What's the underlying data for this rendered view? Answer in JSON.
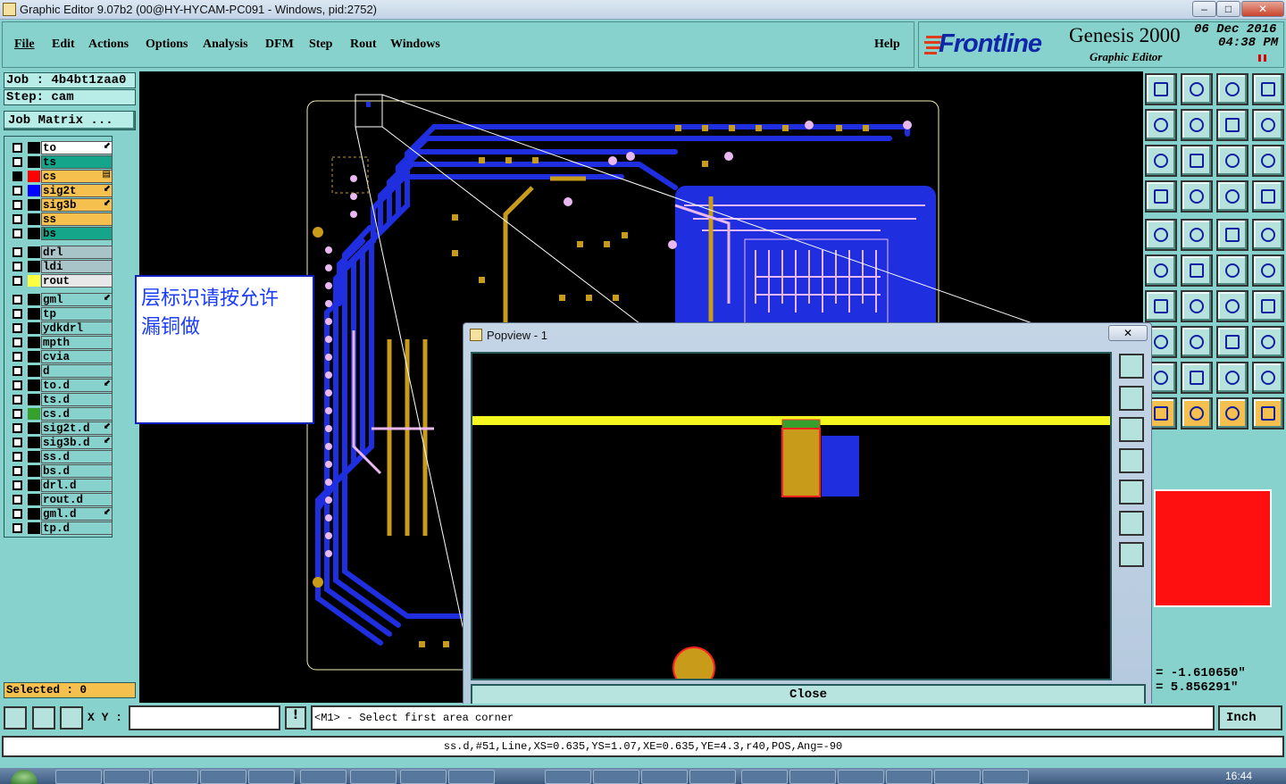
{
  "window": {
    "title": "Graphic Editor 9.07b2 (00@HY-HYCAM-PC091 - Windows, pid:2752)",
    "min": "–",
    "max": "□",
    "close": "✕"
  },
  "menu": {
    "items": [
      "File",
      "Edit",
      "Actions",
      "Options",
      "Analysis",
      "DFM",
      "Step",
      "Rout",
      "Windows"
    ],
    "help": "Help"
  },
  "logo": {
    "brand": "Frontline",
    "product": "Genesis 2000",
    "subtitle": "Graphic Editor",
    "date": "06 Dec 2016",
    "time": "04:38 PM"
  },
  "job": {
    "job_label": "Job : 4b4bt1zaa0",
    "step_label": "Step: cam",
    "matrix_button": "Job Matrix ..."
  },
  "layers": [
    {
      "name": "to",
      "color": "#ffffff",
      "swatch": "#000000",
      "mark": "⬋"
    },
    {
      "name": "ts",
      "color": "#14a58a",
      "swatch": "#000000",
      "mark": ""
    },
    {
      "name": "cs",
      "color": "#f5c04e",
      "swatch": "#ff0000",
      "mark": "▤",
      "selected": true
    },
    {
      "name": "sig2t",
      "color": "#f5c04e",
      "swatch": "#0000ff",
      "mark": "⬋"
    },
    {
      "name": "sig3b",
      "color": "#f5c04e",
      "swatch": "#000000",
      "mark": "⬋"
    },
    {
      "name": "ss",
      "color": "#f5c04e",
      "swatch": "#000000",
      "mark": ""
    },
    {
      "name": "bs",
      "color": "#14a58a",
      "swatch": "#000000",
      "mark": ""
    },
    {
      "name": "drl",
      "color": "#a8c4c8",
      "swatch": "#000000",
      "mark": ""
    },
    {
      "name": "ldi",
      "color": "#a8c4c8",
      "swatch": "#000000",
      "mark": ""
    },
    {
      "name": "rout",
      "color": "#e8e8e8",
      "swatch": "#ffff40",
      "mark": ""
    },
    {
      "name": "gml",
      "color": "#87d2cc",
      "swatch": "#000000",
      "mark": "⬋"
    },
    {
      "name": "tp",
      "color": "#87d2cc",
      "swatch": "#000000",
      "mark": ""
    },
    {
      "name": "ydkdrl",
      "color": "#87d2cc",
      "swatch": "#000000",
      "mark": ""
    },
    {
      "name": "mpth",
      "color": "#87d2cc",
      "swatch": "#000000",
      "mark": ""
    },
    {
      "name": "cvia",
      "color": "#87d2cc",
      "swatch": "#000000",
      "mark": ""
    },
    {
      "name": "d",
      "color": "#87d2cc",
      "swatch": "#000000",
      "mark": ""
    },
    {
      "name": "to.d",
      "color": "#87d2cc",
      "swatch": "#000000",
      "mark": "⬋"
    },
    {
      "name": "ts.d",
      "color": "#87d2cc",
      "swatch": "#000000",
      "mark": ""
    },
    {
      "name": "cs.d",
      "color": "#87d2cc",
      "swatch": "#37a02c",
      "mark": ""
    },
    {
      "name": "sig2t.d",
      "color": "#87d2cc",
      "swatch": "#000000",
      "mark": "⬋"
    },
    {
      "name": "sig3b.d",
      "color": "#87d2cc",
      "swatch": "#000000",
      "mark": "⬋"
    },
    {
      "name": "ss.d",
      "color": "#87d2cc",
      "swatch": "#000000",
      "mark": ""
    },
    {
      "name": "bs.d",
      "color": "#87d2cc",
      "swatch": "#000000",
      "mark": ""
    },
    {
      "name": "drl.d",
      "color": "#87d2cc",
      "swatch": "#000000",
      "mark": ""
    },
    {
      "name": "rout.d",
      "color": "#87d2cc",
      "swatch": "#000000",
      "mark": ""
    },
    {
      "name": "gml.d",
      "color": "#87d2cc",
      "swatch": "#000000",
      "mark": "⬋"
    },
    {
      "name": "tp.d",
      "color": "#87d2cc",
      "swatch": "#000000",
      "mark": ""
    }
  ],
  "selected": "Selected : 0",
  "annotation": {
    "line1": "层标识请按允许",
    "line2": "漏铜做"
  },
  "popup": {
    "title": "Popview - 1",
    "close_label": "Close",
    "x": "✕"
  },
  "coords": {
    "x": "= -1.610650\"",
    "y": "= 5.856291\""
  },
  "bottom": {
    "xy_label": "X Y :",
    "xy_value": "",
    "prompt": "<M1> - Select first area corner",
    "unit": "Inch",
    "status": "ss.d,#51,Line,XS=0.635,YS=1.07,XE=0.635,YE=4.3,r40,POS,Ang=-90"
  },
  "taskbar": {
    "clock": "16:44"
  },
  "colors": {
    "panel": "#87d2cc",
    "copper": "#c89b1a",
    "signal": "#1f2fe0",
    "trace_highlight": "#e9b8f0"
  }
}
